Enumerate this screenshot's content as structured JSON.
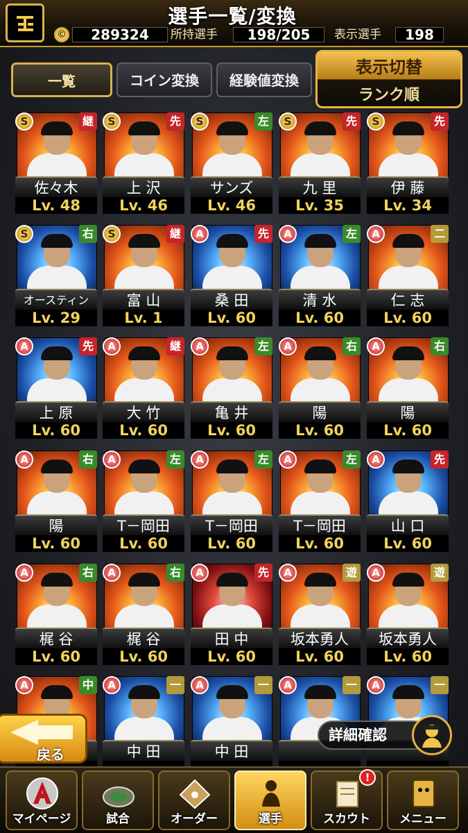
{
  "header": {
    "title": "選手一覧/変換",
    "coins": "289324",
    "owned_label": "所持選手",
    "owned_value": "198/205",
    "shown_label": "表示選手",
    "shown_value": "198"
  },
  "tabs": [
    {
      "label": "一覧",
      "active": true
    },
    {
      "label": "コイン変換",
      "active": false
    },
    {
      "label": "経験値変換",
      "active": false
    }
  ],
  "display_toggle": {
    "label": "表示切替",
    "value": "ランク順"
  },
  "players": [
    {
      "name": "佐々木",
      "level": "Lv. 48",
      "rank": "S",
      "pos": "継",
      "art": "fire"
    },
    {
      "name": "上 沢",
      "level": "Lv. 46",
      "rank": "S",
      "pos": "先",
      "art": "fire"
    },
    {
      "name": "サンズ",
      "level": "Lv. 46",
      "rank": "S",
      "pos": "左",
      "art": "fire"
    },
    {
      "name": "九 里",
      "level": "Lv. 35",
      "rank": "S",
      "pos": "先",
      "art": "fire"
    },
    {
      "name": "伊 藤",
      "level": "Lv. 34",
      "rank": "S",
      "pos": "先",
      "art": "fire"
    },
    {
      "name": "オースティン",
      "level": "Lv. 29",
      "rank": "S",
      "pos": "右",
      "art": "blue"
    },
    {
      "name": "富 山",
      "level": "Lv.  1",
      "rank": "S",
      "pos": "継",
      "art": "fire"
    },
    {
      "name": "桑 田",
      "level": "Lv. 60",
      "rank": "A",
      "pos": "先",
      "art": "blue"
    },
    {
      "name": "清 水",
      "level": "Lv. 60",
      "rank": "A",
      "pos": "左",
      "art": "blue"
    },
    {
      "name": "仁 志",
      "level": "Lv. 60",
      "rank": "A",
      "pos": "二",
      "art": "fire"
    },
    {
      "name": "上 原",
      "level": "Lv. 60",
      "rank": "A",
      "pos": "先",
      "art": "blue"
    },
    {
      "name": "大 竹",
      "level": "Lv. 60",
      "rank": "A",
      "pos": "継",
      "art": "fire"
    },
    {
      "name": "亀 井",
      "level": "Lv. 60",
      "rank": "A",
      "pos": "左",
      "art": "fire"
    },
    {
      "name": "陽",
      "level": "Lv. 60",
      "rank": "A",
      "pos": "右",
      "art": "fire"
    },
    {
      "name": "陽",
      "level": "Lv. 60",
      "rank": "A",
      "pos": "右",
      "art": "fire"
    },
    {
      "name": "陽",
      "level": "Lv. 60",
      "rank": "A",
      "pos": "右",
      "art": "fire"
    },
    {
      "name": "T－岡田",
      "level": "Lv. 60",
      "rank": "A",
      "pos": "左",
      "art": "fire"
    },
    {
      "name": "T－岡田",
      "level": "Lv. 60",
      "rank": "A",
      "pos": "左",
      "art": "fire"
    },
    {
      "name": "T－岡田",
      "level": "Lv. 60",
      "rank": "A",
      "pos": "左",
      "art": "fire"
    },
    {
      "name": "山 口",
      "level": "Lv. 60",
      "rank": "A",
      "pos": "先",
      "art": "blue"
    },
    {
      "name": "梶 谷",
      "level": "Lv. 60",
      "rank": "A",
      "pos": "右",
      "art": "fire"
    },
    {
      "name": "梶 谷",
      "level": "Lv. 60",
      "rank": "A",
      "pos": "右",
      "art": "fire"
    },
    {
      "name": "田 中",
      "level": "Lv. 60",
      "rank": "A",
      "pos": "先",
      "art": "red"
    },
    {
      "name": "坂本勇人",
      "level": "Lv. 60",
      "rank": "A",
      "pos": "遊",
      "art": "fire"
    },
    {
      "name": "坂本勇人",
      "level": "Lv. 60",
      "rank": "A",
      "pos": "遊",
      "art": "fire"
    },
    {
      "name": "",
      "level": "",
      "rank": "A",
      "pos": "中",
      "art": "fire"
    },
    {
      "name": "中 田",
      "level": "",
      "rank": "A",
      "pos": "一",
      "art": "blue"
    },
    {
      "name": "中 田",
      "level": "",
      "rank": "A",
      "pos": "一",
      "art": "blue"
    },
    {
      "name": "",
      "level": "",
      "rank": "A",
      "pos": "一",
      "art": "blue"
    },
    {
      "name": "",
      "level": "",
      "rank": "A",
      "pos": "一",
      "art": "blue"
    }
  ],
  "buttons": {
    "back": "戻る",
    "detail": "詳細確認"
  },
  "nav": [
    {
      "label": "マイページ",
      "icon": "a-emblem-icon"
    },
    {
      "label": "試合",
      "icon": "stadium-icon"
    },
    {
      "label": "オーダー",
      "icon": "field-icon"
    },
    {
      "label": "選手",
      "icon": "player-icon",
      "active": true
    },
    {
      "label": "スカウト",
      "icon": "scout-icon",
      "badge": "!"
    },
    {
      "label": "メニュー",
      "icon": "menu-icon"
    }
  ]
}
